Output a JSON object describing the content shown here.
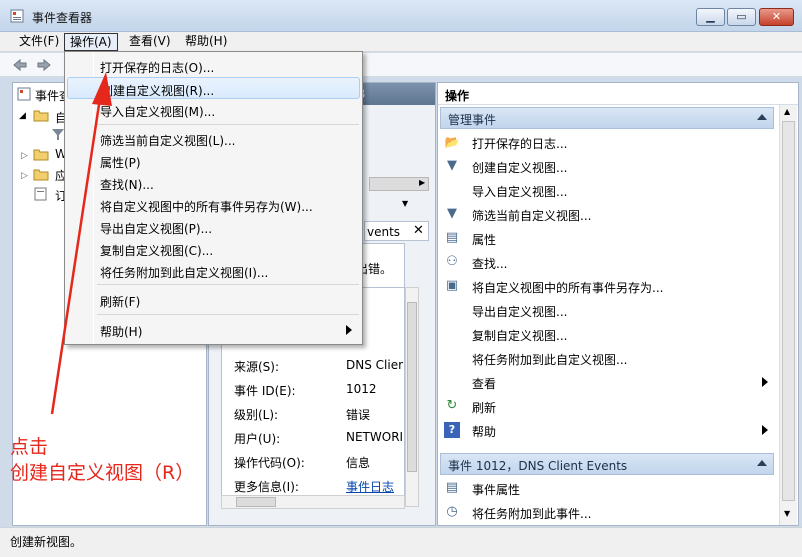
{
  "window": {
    "title": "事件查看器",
    "min_glyph": "▁",
    "max_glyph": "▭",
    "close_glyph": "✕"
  },
  "menubar": {
    "file": "文件(F)",
    "action": "操作(A)",
    "view": "查看(V)",
    "help": "帮助(H)"
  },
  "tree": {
    "item_0": "事件查",
    "item_1": "自",
    "item_2": "W",
    "item_3": "应",
    "item_4": "订"
  },
  "middle": {
    "header_arrow": "B",
    "events_tab_partial": "vents",
    "events_tab_close": "✕",
    "error_partial": "付出错。",
    "system_partial": "统",
    "detail_rows": [
      {
        "label": "来源(S):",
        "value": "DNS Clier"
      },
      {
        "label": "事件 ID(E):",
        "value": "1012"
      },
      {
        "label": "级别(L):",
        "value": "错误"
      },
      {
        "label": "用户(U):",
        "value": "NETWORI"
      },
      {
        "label": "操作代码(O):",
        "value": "信息"
      },
      {
        "label": "更多信息(I):",
        "value": "事件日志"
      }
    ]
  },
  "actions": {
    "title": "操作",
    "section_manage": "管理事件",
    "manage_items": [
      {
        "icon": "open-folder-icon",
        "glyph": "📂",
        "label": "打开保存的日志...",
        "submenu": false
      },
      {
        "icon": "filter-icon",
        "glyph": "▼",
        "label": "创建自定义视图...",
        "submenu": false
      },
      {
        "icon": "",
        "glyph": "",
        "label": "导入自定义视图...",
        "submenu": false
      },
      {
        "icon": "filter-icon",
        "glyph": "▼",
        "label": "筛选当前自定义视图...",
        "submenu": false
      },
      {
        "icon": "properties-icon",
        "glyph": "▤",
        "label": "属性",
        "submenu": false
      },
      {
        "icon": "binoculars-icon",
        "glyph": "⚇",
        "label": "查找...",
        "submenu": false
      },
      {
        "icon": "save-icon",
        "glyph": "▣",
        "label": "将自定义视图中的所有事件另存为...",
        "submenu": false
      },
      {
        "icon": "",
        "glyph": "",
        "label": "导出自定义视图...",
        "submenu": false
      },
      {
        "icon": "",
        "glyph": "",
        "label": "复制自定义视图...",
        "submenu": false
      },
      {
        "icon": "",
        "glyph": "",
        "label": "将任务附加到此自定义视图...",
        "submenu": false
      },
      {
        "icon": "",
        "glyph": "",
        "label": "查看",
        "submenu": true
      },
      {
        "icon": "refresh-icon",
        "glyph": "↻",
        "label": "刷新",
        "submenu": false
      },
      {
        "icon": "help-icon",
        "glyph": "?",
        "label": "帮助",
        "submenu": true
      }
    ],
    "section_event": "事件 1012，DNS Client Events",
    "event_items": [
      {
        "icon": "event-properties-icon",
        "glyph": "▤",
        "label": "事件属性"
      },
      {
        "icon": "task-icon",
        "glyph": "◷",
        "label": "将任务附加到此事件..."
      }
    ]
  },
  "dropdown": {
    "items": [
      {
        "label": "打开保存的日志(O)...",
        "highlight": false,
        "submenu": false
      },
      {
        "label": "创建自定义视图(R)...",
        "highlight": true,
        "submenu": false
      },
      {
        "label": "导入自定义视图(M)...",
        "highlight": false,
        "submenu": false
      },
      {
        "label": "筛选当前自定义视图(L)...",
        "highlight": false,
        "submenu": false
      },
      {
        "label": "属性(P)",
        "highlight": false,
        "submenu": false
      },
      {
        "label": "查找(N)...",
        "highlight": false,
        "submenu": false
      },
      {
        "label": "将自定义视图中的所有事件另存为(W)...",
        "highlight": false,
        "submenu": false
      },
      {
        "label": "导出自定义视图(P)...",
        "highlight": false,
        "submenu": false
      },
      {
        "label": "复制自定义视图(C)...",
        "highlight": false,
        "submenu": false
      },
      {
        "label": "将任务附加到此自定义视图(I)...",
        "highlight": false,
        "submenu": false
      },
      {
        "label": "刷新(F)",
        "highlight": false,
        "submenu": false
      },
      {
        "label": "帮助(H)",
        "highlight": false,
        "submenu": true
      }
    ]
  },
  "status": {
    "text": "创建新视图。"
  },
  "annotation": {
    "line1": "点击",
    "line2": "创建自定义视图（R）",
    "color": "#e6271c"
  }
}
